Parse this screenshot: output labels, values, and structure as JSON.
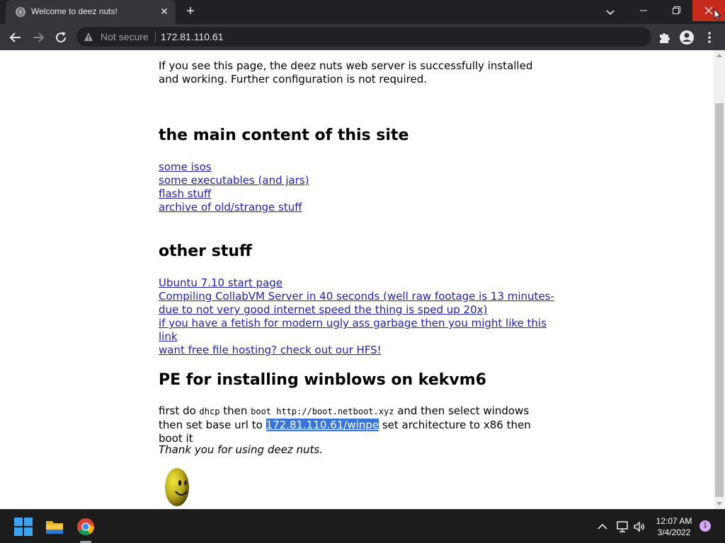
{
  "browser": {
    "tab_title": "Welcome to deez nuts!",
    "security_label": "Not secure",
    "url": "172.81.110.61"
  },
  "page": {
    "intro": "If you see this page, the deez nuts web server is successfully installed and working. Further configuration is not required.",
    "main_heading": "the main content of this site",
    "main_links": [
      "some isos",
      "some executables (and jars)",
      "flash stuff",
      "archive of old/strange stuff"
    ],
    "other_heading": "other stuff",
    "other_links": [
      "Ubuntu 7.10 start page",
      "Compiling CollabVM Server in 40 seconds (well raw footage is 13 minutes- due to not very good internet speed the thing is sped up 20x)",
      "if you have a fetish for modern ugly ass garbage then you might like this link",
      "want free file hosting? check out our HFS!"
    ],
    "pe_heading": "PE for installing winblows on kekvm6",
    "pe": {
      "t1": "first do ",
      "code1": "dhcp",
      "t2": " then ",
      "code2": "boot http://boot.netboot.xyz",
      "t3": " and then select windows then set base url to ",
      "selected": "172.81.110.61/winpe",
      "t4": " set architecture to x86 then boot it"
    },
    "thanks": "Thank you for using deez nuts."
  },
  "taskbar": {
    "time": "12:07 AM",
    "date": "3/4/2022",
    "notification_count": "1",
    "icons": [
      "windows-start-icon",
      "file-explorer-icon",
      "chrome-icon"
    ]
  },
  "colors": {
    "link": "#1f1fa8",
    "selection": "#3875d6",
    "close_button": "#c42b1c"
  }
}
